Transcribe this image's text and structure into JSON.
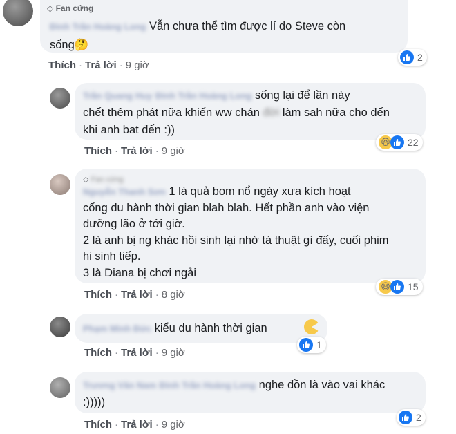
{
  "comments": [
    {
      "badge": "Fan cứng",
      "name": "Đinh Trần Hoàng Long",
      "text_line1": "Vẫn chưa thể tìm được lí do Steve còn",
      "text_line2": "sống",
      "emoji": "🤔",
      "like_label": "Thích",
      "reply_label": "Trả lời",
      "time": "9 giờ",
      "reaction_count": "2",
      "reaction": "like"
    },
    {
      "name": "Trần Quang Huy",
      "tag": "Đinh Trần Hoàng Long",
      "text_line1": "sống lại để lần này",
      "text_line2_a": "chết thêm phát nữa khiến ww chán",
      "text_line2_blur": "đời",
      "text_line2_b": "làm sah nữa cho đến",
      "text_line3": "khi anh bat đến :))",
      "like_label": "Thích",
      "reply_label": "Trả lời",
      "time": "9 giờ",
      "reaction_count": "22",
      "reaction": "haha-like"
    },
    {
      "badge": "Fan cứng",
      "name": "Nguyễn Thanh Sơn",
      "text_line1": "1 là quả bom nổ ngày xưa kích hoạt",
      "text_line2": "cổng du hành thời gian blah blah. Hết phần anh vào viện",
      "text_line3": "dưỡng lão ở tới giờ.",
      "text_line4": "2 là anh bị ng khác hồi sinh lại nhờ tà thuật gì đấy, cuối phim",
      "text_line5": "hi sinh tiếp.",
      "text_line6": "3 là Diana bị chơi ngải",
      "like_label": "Thích",
      "reply_label": "Trả lời",
      "time": "8 giờ",
      "reaction_count": "15",
      "reaction": "haha-like"
    },
    {
      "name": "Phạm Minh Đức",
      "text_line1": "kiểu du hành thời gian",
      "like_label": "Thích",
      "reply_label": "Trả lời",
      "time": "9 giờ",
      "reaction_count": "1",
      "reaction": "like"
    },
    {
      "name": "Trương Văn Nam",
      "tag": "Đinh Trần Hoàng Long",
      "text_line1": "nghe đồn là vào vai khác",
      "text_line2": ":)))))",
      "like_label": "Thích",
      "reply_label": "Trả lời",
      "time": "9 giờ",
      "reaction_count": "2",
      "reaction": "like"
    }
  ],
  "sep": "·",
  "colors": {
    "like_blue": "#1877f2",
    "bubble": "#f0f2f5",
    "haha_yellow": "#f7c94b"
  }
}
